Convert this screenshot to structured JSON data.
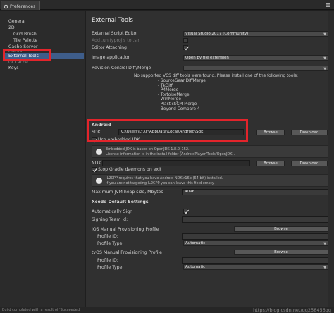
{
  "window": {
    "tab_title": "Preferences"
  },
  "sidebar": {
    "items": [
      {
        "label": "General"
      },
      {
        "label": "2D"
      },
      {
        "label": "Grid Brush"
      },
      {
        "label": "Tile Palette"
      },
      {
        "label": "Cache Server"
      },
      {
        "label": "Colors"
      },
      {
        "label": "External Tools"
      },
      {
        "label": "GI Cache"
      },
      {
        "label": "Keys"
      }
    ]
  },
  "main": {
    "title": "External Tools",
    "external_script_editor": {
      "label": "External Script Editor",
      "value": "Visual Studio 2017 (Community)"
    },
    "add_unityproj": {
      "label": "Add .unityproj's to .sln",
      "checked": false
    },
    "editor_attaching": {
      "label": "Editor Attaching",
      "checked": true
    },
    "image_application": {
      "label": "Image application",
      "value": "Open by file extension"
    },
    "revision_control": {
      "label": "Revision Control Diff/Merge",
      "value": ""
    },
    "vcs_notice": {
      "line": "No supported VCS diff tools were found. Please install one of the following tools:",
      "tools": [
        "- SourceGear DiffMerge",
        "- TkDiff",
        "- P4Merge",
        "- TortoiseMerge",
        "- WinMerge",
        "- PlasticSCM Merge",
        "- Beyond Compare 4"
      ]
    },
    "android": {
      "section_label": "Android",
      "sdk_label": "SDK",
      "sdk_path": "C:\\Users\\LYXF\\AppData\\Local\\Android\\Sdk",
      "browse_label": "Browse",
      "download_label": "Download",
      "use_embedded_jdk": {
        "label": "Use embedded JDK",
        "checked": true
      },
      "jdk_info_line1": "Embedded JDK is based on OpenJDK 1.8.0_152.",
      "jdk_info_line2": "License information is in the install folder (AndroidPlayer/Tools/OpenJDK).",
      "ndk_label": "NDK",
      "ndk_path": "",
      "stop_gradle": {
        "label": "Stop Gradle daemons on exit",
        "checked": true
      },
      "il2cpp_line1": "IL2CPP requires that you have Android NDK r16b (64-bit) installed.",
      "il2cpp_line2": "If you are not targeting IL2CPP you can leave this field empty.",
      "max_heap_label": "Maximum JVM heap size, Mbytes",
      "max_heap_value": "4096"
    },
    "xcode": {
      "section_label": "Xcode Default Settings",
      "auto_sign": {
        "label": "Automatically Sign",
        "checked": true
      },
      "signing_team_label": "Signing Team Id:",
      "ios_profile_label": "iOS Manual Provisioning Profile",
      "ios_browse": "Browse",
      "ios_profile_id_label": "Profile ID:",
      "ios_profile_type_label": "Profile Type:",
      "ios_profile_type_value": "Automatic",
      "tvos_profile_label": "tvOS Manual Provisioning Profile",
      "tvos_browse": "Browse",
      "tvos_profile_id_label": "Profile ID:",
      "tvos_profile_type_label": "Profile Type:",
      "tvos_profile_type_value": "Automatic"
    }
  },
  "status_bar": {
    "text": "Build completed with a result of 'Succeeded'",
    "watermark": "https://blog.csdn.net/qq258456qq"
  },
  "colors": {
    "highlight_red": "#e3242b",
    "selection_blue": "#3e5d8a",
    "panel_bg": "#303030"
  }
}
